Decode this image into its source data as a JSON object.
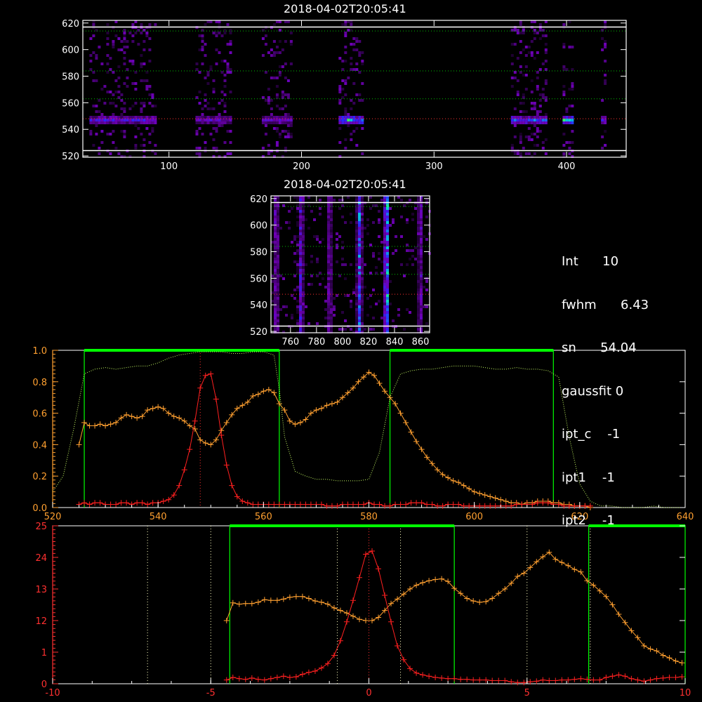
{
  "titles": {
    "top": "2018-04-02T20:05:41",
    "middle": "2018-04-02T20:05:41"
  },
  "params": [
    {
      "label": "Int",
      "value": "10"
    },
    {
      "label": "fwhm",
      "value": "6.43"
    },
    {
      "label": "sn",
      "value": "54.04"
    },
    {
      "label": "gaussfit",
      "value": "0"
    },
    {
      "label": "ipt_c",
      "value": "-1"
    },
    {
      "label": "ipt1",
      "value": "-1"
    },
    {
      "label": "ipt2",
      "value": "-1"
    }
  ],
  "colors": {
    "background": "#000000",
    "axis": "#ffffff",
    "gaussian_curve": "#ff2020",
    "spectrum_curve": "#ffa030",
    "green_band": "#00ff00",
    "reference_curve": "#c8ff64",
    "peak_row_line": "#ff3030",
    "grid_dotted": "#00c000"
  },
  "chart_data": [
    {
      "type": "heatmap",
      "name": "detector-image-full",
      "title": "2018-04-02T20:05:41",
      "xlim": [
        35,
        445
      ],
      "ylim": [
        519,
        622
      ],
      "xticks": [
        100,
        200,
        300,
        400
      ],
      "yticks": [
        520,
        540,
        560,
        580,
        600,
        620
      ],
      "colormap": "black-purple-blue-green-yellow",
      "bright_row": 548,
      "dotted_rows": [
        548,
        563,
        584,
        614
      ],
      "white_rows": [
        524,
        617
      ],
      "bands": [
        {
          "x0": 40,
          "x1": 90,
          "core": 548,
          "peak": 0.55
        },
        {
          "x0": 120,
          "x1": 147,
          "core": 548,
          "peak": 0.45
        },
        {
          "x0": 170,
          "x1": 193,
          "core": 548,
          "peak": 0.4
        },
        {
          "x0": 228,
          "x1": 245,
          "core": 548,
          "peak": 0.95
        },
        {
          "x0": 358,
          "x1": 384,
          "core": 548,
          "peak": 0.75
        },
        {
          "x0": 397,
          "x1": 405,
          "core": 548,
          "peak": 1.0
        },
        {
          "x0": 426,
          "x1": 429,
          "core": 548,
          "peak": 0.5
        }
      ]
    },
    {
      "type": "heatmap",
      "name": "detector-image-zoom",
      "title": "2018-04-02T20:05:41",
      "xlim": [
        745,
        867
      ],
      "ylim": [
        519,
        622
      ],
      "xticks": [
        760,
        780,
        800,
        820,
        840,
        860
      ],
      "yticks": [
        520,
        540,
        560,
        580,
        600,
        620
      ],
      "colormap": "black-purple-blue-green-yellow",
      "dotted_rows": [
        548,
        563,
        584,
        614
      ],
      "white_rows": [
        524,
        617
      ],
      "stripes": [
        {
          "x": 748,
          "peak": 0.5
        },
        {
          "x": 767,
          "peak": 0.6
        },
        {
          "x": 789,
          "peak": 0.45
        },
        {
          "x": 812,
          "peak": 0.75
        },
        {
          "x": 833,
          "peak": 1.0
        },
        {
          "x": 859,
          "peak": 0.45
        }
      ]
    },
    {
      "type": "line",
      "name": "spectrum-vs-wavelength",
      "xlim": [
        520,
        640
      ],
      "ylim": [
        0,
        1.0
      ],
      "xticks": [
        520,
        540,
        560,
        580,
        600,
        620,
        640
      ],
      "ytick_labels": [
        "0.0",
        "0.2",
        "0.4",
        "0.6",
        "0.8",
        "1.0"
      ],
      "right_ytick_values": [
        0,
        0.2,
        0.4,
        0.6,
        0.8,
        1.0
      ],
      "vlines_dotted": [
        548
      ],
      "green_boxes": [
        [
          526,
          563
        ],
        [
          584,
          615
        ]
      ],
      "series": [
        {
          "type": "orange",
          "x": [
            525,
            526,
            527,
            528,
            529,
            530,
            531,
            532,
            533,
            534,
            535,
            536,
            537,
            538,
            539,
            540,
            541,
            542,
            543,
            544,
            545,
            546,
            547,
            548,
            549,
            550,
            551,
            552,
            553,
            554,
            555,
            556,
            557,
            558,
            559,
            560,
            561,
            562,
            563,
            564,
            565,
            566,
            567,
            568,
            569,
            570,
            571,
            572,
            573,
            574,
            575,
            576,
            577,
            578,
            579,
            580,
            581,
            582,
            583,
            584,
            585,
            586,
            587,
            588,
            589,
            590,
            591,
            592,
            593,
            594,
            595,
            596,
            597,
            598,
            599,
            600,
            601,
            602,
            603,
            604,
            605,
            606,
            607,
            608,
            609,
            610,
            611,
            612,
            613,
            614,
            615,
            616,
            617,
            618,
            619,
            620,
            621,
            622
          ],
          "y": [
            0.4,
            0.54,
            0.52,
            0.52,
            0.53,
            0.52,
            0.53,
            0.54,
            0.57,
            0.59,
            0.58,
            0.57,
            0.58,
            0.62,
            0.63,
            0.64,
            0.63,
            0.6,
            0.58,
            0.57,
            0.55,
            0.52,
            0.5,
            0.43,
            0.41,
            0.4,
            0.43,
            0.49,
            0.54,
            0.59,
            0.63,
            0.65,
            0.67,
            0.71,
            0.72,
            0.74,
            0.75,
            0.73,
            0.66,
            0.62,
            0.55,
            0.53,
            0.54,
            0.56,
            0.6,
            0.62,
            0.63,
            0.65,
            0.66,
            0.67,
            0.7,
            0.73,
            0.76,
            0.8,
            0.83,
            0.86,
            0.84,
            0.79,
            0.74,
            0.7,
            0.66,
            0.6,
            0.54,
            0.48,
            0.42,
            0.37,
            0.32,
            0.28,
            0.24,
            0.21,
            0.19,
            0.17,
            0.16,
            0.14,
            0.12,
            0.1,
            0.09,
            0.08,
            0.07,
            0.06,
            0.05,
            0.04,
            0.03,
            0.03,
            0.02,
            0.03,
            0.03,
            0.04,
            0.04,
            0.04,
            0.03,
            0.03,
            0.02,
            0.02,
            0.01,
            0.01,
            0.01,
            0.0
          ]
        },
        {
          "type": "red",
          "x": [
            525,
            526,
            527,
            528,
            529,
            530,
            531,
            532,
            533,
            534,
            535,
            536,
            537,
            538,
            539,
            540,
            541,
            542,
            543,
            544,
            545,
            546,
            547,
            548,
            549,
            550,
            551,
            552,
            553,
            554,
            555,
            556,
            557,
            558,
            559,
            560,
            561,
            562,
            563,
            564,
            565,
            566,
            567,
            568,
            569,
            570,
            571,
            572,
            573,
            574,
            575,
            576,
            577,
            578,
            579,
            580,
            581,
            582,
            583,
            584,
            585,
            586,
            587,
            588,
            589,
            590,
            591,
            592,
            593,
            594,
            595,
            596,
            597,
            598,
            599,
            600,
            601,
            602,
            603,
            604,
            605,
            606,
            607,
            608,
            609,
            610,
            611,
            612,
            613,
            614,
            615,
            616,
            617,
            618,
            619,
            620,
            621,
            622
          ],
          "y": [
            0.02,
            0.03,
            0.02,
            0.03,
            0.03,
            0.02,
            0.02,
            0.02,
            0.03,
            0.03,
            0.02,
            0.03,
            0.03,
            0.02,
            0.03,
            0.03,
            0.04,
            0.05,
            0.08,
            0.14,
            0.24,
            0.37,
            0.55,
            0.76,
            0.84,
            0.85,
            0.69,
            0.46,
            0.27,
            0.14,
            0.07,
            0.04,
            0.03,
            0.02,
            0.02,
            0.02,
            0.02,
            0.02,
            0.02,
            0.02,
            0.02,
            0.02,
            0.02,
            0.02,
            0.02,
            0.02,
            0.02,
            0.01,
            0.01,
            0.01,
            0.02,
            0.02,
            0.02,
            0.02,
            0.02,
            0.03,
            0.02,
            0.02,
            0.01,
            0.01,
            0.02,
            0.02,
            0.02,
            0.03,
            0.03,
            0.03,
            0.02,
            0.02,
            0.01,
            0.01,
            0.02,
            0.02,
            0.02,
            0.01,
            0.01,
            0.01,
            0.01,
            0.01,
            0.01,
            0.01,
            0.01,
            0.01,
            0.01,
            0.02,
            0.02,
            0.02,
            0.02,
            0.03,
            0.03,
            0.03,
            0.02,
            0.02,
            0.01,
            0.01,
            0.01,
            0.01,
            0.01,
            0.01
          ]
        },
        {
          "type": "reference-dotted",
          "x": [
            520,
            522,
            524,
            526,
            528,
            530,
            532,
            534,
            536,
            538,
            540,
            542,
            544,
            546,
            548,
            550,
            552,
            554,
            556,
            558,
            560,
            562,
            563,
            564,
            566,
            568,
            570,
            572,
            574,
            576,
            578,
            580,
            582,
            584,
            586,
            588,
            590,
            592,
            594,
            596,
            598,
            600,
            602,
            604,
            606,
            608,
            610,
            612,
            614,
            616,
            618,
            620,
            622,
            624,
            626,
            628,
            630,
            632,
            634,
            636,
            638,
            640
          ],
          "y": [
            0.1,
            0.2,
            0.5,
            0.85,
            0.88,
            0.89,
            0.88,
            0.89,
            0.9,
            0.9,
            0.92,
            0.95,
            0.97,
            0.98,
            0.99,
            0.99,
            0.99,
            0.98,
            0.98,
            0.99,
            0.99,
            0.97,
            0.75,
            0.45,
            0.23,
            0.2,
            0.18,
            0.18,
            0.17,
            0.17,
            0.17,
            0.18,
            0.35,
            0.7,
            0.85,
            0.87,
            0.88,
            0.88,
            0.89,
            0.9,
            0.9,
            0.9,
            0.89,
            0.88,
            0.88,
            0.89,
            0.88,
            0.88,
            0.87,
            0.83,
            0.45,
            0.15,
            0.04,
            0.01,
            0.01,
            0.0,
            0.0,
            0.0,
            0.01,
            0.0,
            0.0,
            0.0
          ]
        }
      ]
    },
    {
      "type": "line",
      "name": "spectrum-vs-offset",
      "xlim": [
        -10,
        10
      ],
      "ylim": [
        0,
        2.5
      ],
      "xticks": [
        -10,
        -5,
        0,
        5,
        10
      ],
      "ytick_labels": [
        "0",
        "1",
        "12",
        "13",
        "24",
        "25"
      ],
      "right_ytick_values": [
        0,
        0.5,
        1.0,
        1.5,
        2.0,
        2.5
      ],
      "vlines_dotted": [
        -7,
        -5,
        -1,
        0,
        1,
        5,
        7
      ],
      "green_boxes": [
        [
          -4.4,
          2.7
        ],
        [
          6.95,
          10
        ]
      ],
      "series": [
        {
          "type": "orange",
          "x": [
            -4.5,
            -4.3,
            -4.1,
            -3.9,
            -3.7,
            -3.5,
            -3.3,
            -3.1,
            -2.9,
            -2.7,
            -2.5,
            -2.3,
            -2.1,
            -1.9,
            -1.7,
            -1.5,
            -1.3,
            -1.1,
            -0.9,
            -0.7,
            -0.5,
            -0.3,
            -0.1,
            0.1,
            0.3,
            0.5,
            0.7,
            0.9,
            1.1,
            1.3,
            1.5,
            1.7,
            1.9,
            2.1,
            2.3,
            2.5,
            2.7,
            2.9,
            3.1,
            3.3,
            3.5,
            3.7,
            3.9,
            4.1,
            4.3,
            4.5,
            4.7,
            4.9,
            5.1,
            5.3,
            5.5,
            5.7,
            5.9,
            6.1,
            6.3,
            6.5,
            6.7,
            6.9,
            7.1,
            7.3,
            7.5,
            7.7,
            7.9,
            8.1,
            8.3,
            8.5,
            8.7,
            8.9,
            9.1,
            9.3,
            9.5,
            9.7,
            9.9
          ],
          "y": [
            1.0,
            1.28,
            1.26,
            1.27,
            1.27,
            1.29,
            1.33,
            1.32,
            1.32,
            1.34,
            1.37,
            1.38,
            1.38,
            1.35,
            1.31,
            1.29,
            1.26,
            1.2,
            1.16,
            1.12,
            1.07,
            1.02,
            1.0,
            1.0,
            1.05,
            1.16,
            1.27,
            1.34,
            1.42,
            1.5,
            1.56,
            1.6,
            1.63,
            1.65,
            1.66,
            1.62,
            1.51,
            1.43,
            1.35,
            1.31,
            1.29,
            1.3,
            1.35,
            1.43,
            1.5,
            1.59,
            1.7,
            1.75,
            1.84,
            1.93,
            2.01,
            2.08,
            1.97,
            1.92,
            1.87,
            1.81,
            1.77,
            1.63,
            1.56,
            1.47,
            1.38,
            1.25,
            1.1,
            0.97,
            0.84,
            0.73,
            0.6,
            0.55,
            0.52,
            0.45,
            0.41,
            0.36,
            0.33
          ]
        },
        {
          "type": "red",
          "x": [
            -4.5,
            -4.3,
            -4.1,
            -3.9,
            -3.7,
            -3.5,
            -3.3,
            -3.1,
            -2.9,
            -2.7,
            -2.5,
            -2.3,
            -2.1,
            -1.9,
            -1.7,
            -1.5,
            -1.3,
            -1.1,
            -0.9,
            -0.7,
            -0.5,
            -0.3,
            -0.1,
            0.1,
            0.3,
            0.5,
            0.7,
            0.9,
            1.1,
            1.3,
            1.5,
            1.7,
            1.9,
            2.1,
            2.3,
            2.5,
            2.7,
            2.9,
            3.1,
            3.3,
            3.5,
            3.7,
            3.9,
            4.1,
            4.3,
            4.5,
            4.7,
            4.9,
            5.1,
            5.3,
            5.5,
            5.7,
            5.9,
            6.1,
            6.3,
            6.5,
            6.7,
            6.9,
            7.1,
            7.3,
            7.5,
            7.7,
            7.9,
            8.1,
            8.3,
            8.5,
            8.7,
            8.9,
            9.1,
            9.3,
            9.5,
            9.7,
            9.9
          ],
          "y": [
            0.06,
            0.1,
            0.08,
            0.07,
            0.09,
            0.07,
            0.06,
            0.08,
            0.1,
            0.12,
            0.1,
            0.11,
            0.15,
            0.18,
            0.2,
            0.25,
            0.32,
            0.45,
            0.68,
            0.98,
            1.32,
            1.68,
            2.05,
            2.1,
            1.82,
            1.4,
            0.98,
            0.6,
            0.38,
            0.24,
            0.17,
            0.14,
            0.12,
            0.1,
            0.09,
            0.08,
            0.08,
            0.07,
            0.07,
            0.06,
            0.06,
            0.06,
            0.05,
            0.05,
            0.05,
            0.03,
            0.02,
            0.02,
            0.03,
            0.04,
            0.06,
            0.05,
            0.05,
            0.06,
            0.06,
            0.07,
            0.08,
            0.07,
            0.06,
            0.06,
            0.1,
            0.12,
            0.14,
            0.12,
            0.08,
            0.06,
            0.04,
            0.06,
            0.08,
            0.09,
            0.1,
            0.1,
            0.11
          ]
        }
      ]
    }
  ]
}
